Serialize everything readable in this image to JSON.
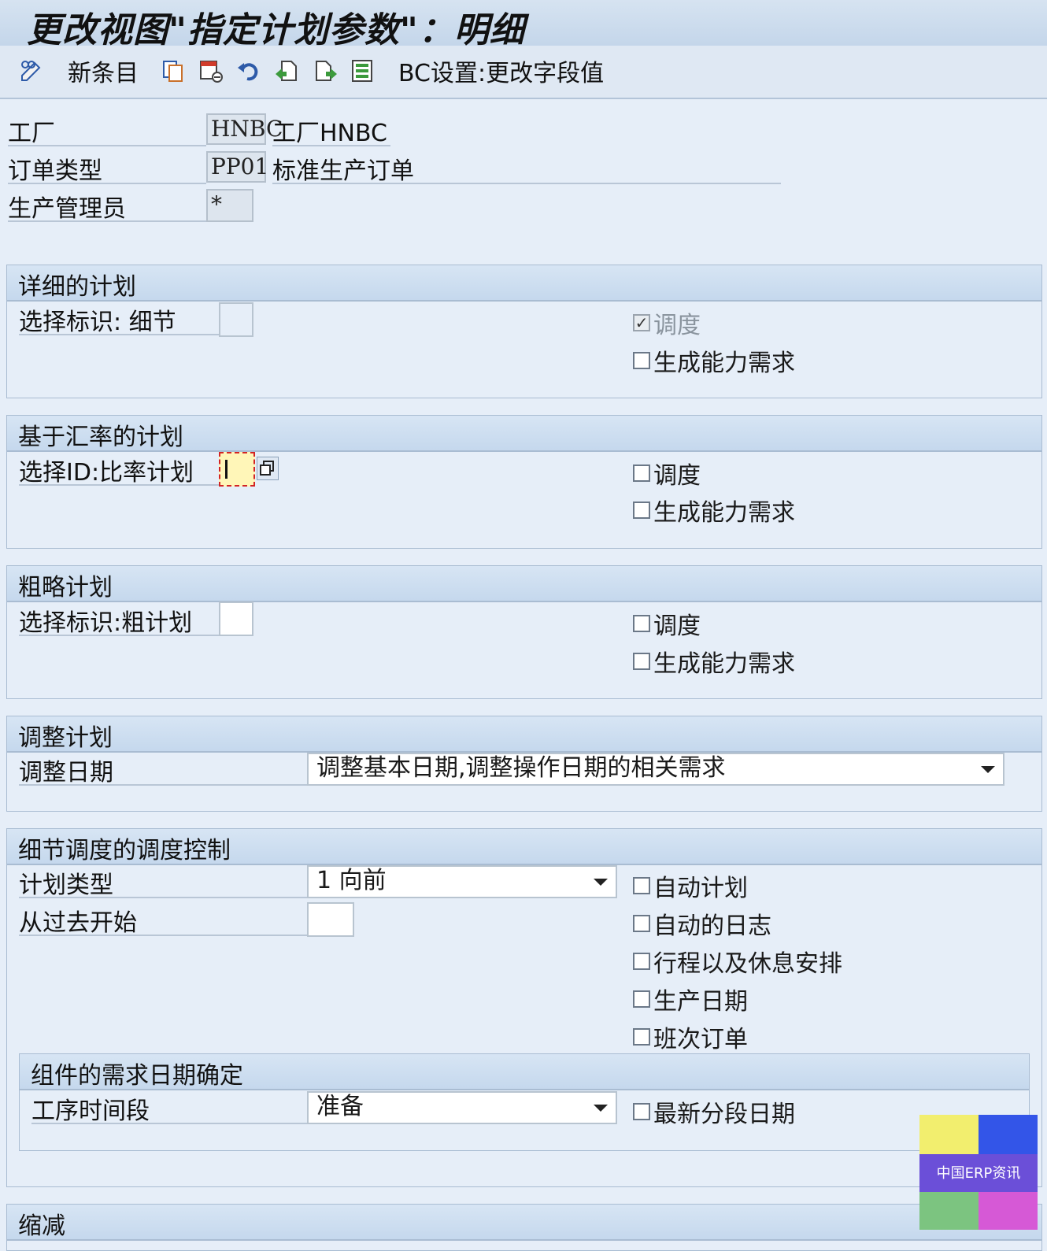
{
  "window": {
    "title": "更改视图\"指定计划参数\"：明细"
  },
  "toolbar": {
    "new_entries": "新条目",
    "bc_set": "BC设置:更改字段值",
    "icons": [
      "display-change-icon",
      "copy-icon",
      "delete-icon",
      "undo-icon",
      "previous-entry-icon",
      "next-entry-icon",
      "select-all-icon"
    ]
  },
  "header": {
    "plant_label": "工厂",
    "plant_value": "HNBC",
    "plant_desc": "工厂HNBC",
    "order_type_label": "订单类型",
    "order_type_value": "PP01",
    "order_type_desc": "标准生产订单",
    "scheduler_label": "生产管理员",
    "scheduler_value": "*"
  },
  "detailed_planning": {
    "title": "详细的计划",
    "select_label": "选择标识: 细节",
    "scheduling": "调度",
    "scheduling_checked": true,
    "capacity": "生成能力需求"
  },
  "rate_based": {
    "title": "基于汇率的计划",
    "select_label": "选择ID:比率计划",
    "scheduling": "调度",
    "capacity": "生成能力需求"
  },
  "rough_cut": {
    "title": "粗略计划",
    "select_label": "选择标识:粗计划",
    "scheduling": "调度",
    "capacity": "生成能力需求"
  },
  "adjust": {
    "title": "调整计划",
    "date_label": "调整日期",
    "date_value": "调整基本日期,调整操作日期的相关需求"
  },
  "scheduling_control": {
    "title": "细节调度的调度控制",
    "type_label": "计划类型",
    "type_value": "1 向前",
    "start_label": "从过去开始",
    "auto_plan": "自动计划",
    "auto_log": "自动的日志",
    "breaks": "行程以及休息安排",
    "prod_date": "生产日期",
    "shift_order": "班次订单"
  },
  "component_req": {
    "title": "组件的需求日期确定",
    "segment_label": "工序时间段",
    "segment_value": "准备",
    "latest_date": "最新分段日期"
  },
  "reduction": {
    "title": "缩减"
  },
  "watermark": {
    "text": "中国ERP资讯",
    "colors": [
      "#f2ee6e",
      "#3355e8",
      "#6b4fd8",
      "#7cc480",
      "#d659d6"
    ]
  }
}
